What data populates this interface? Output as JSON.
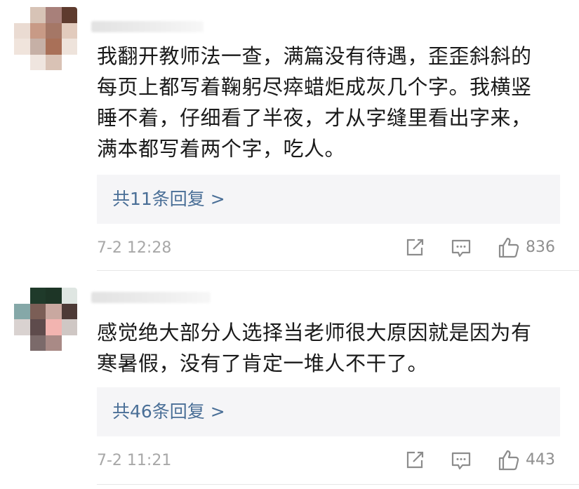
{
  "comments": [
    {
      "text_line1": "我翻开教师法一查，满篇没有待遇，歪歪斜斜的",
      "text_line2": "每页上都写着鞠躬尽瘁蜡炬成灰几个字。我横竖",
      "text_line3": "睡不着，仔细看了半夜，才从字缝里看出字来，",
      "text_line4": "满本都写着两个字，吃人。",
      "replies_label": "共11条回复 >",
      "time": "7-2 12:28",
      "like_count": "836",
      "avatar_colors": [
        "#ffffff",
        "#d7c3b6",
        "#a8807a",
        "#5e3b2e",
        "#eadbd2",
        "#c89a86",
        "#a57766",
        "#e2cbbd",
        "#f0e4dc",
        "#c6b0a6",
        "#a97058",
        "#eee3db",
        "#ffffff",
        "#efe5df",
        "#d9c2b5",
        "#ffffff"
      ]
    },
    {
      "text_line1": "感觉绝大部分人选择当老师很大原因就是因为有",
      "text_line2": "寒暑假，没有了肯定一堆人不干了。",
      "replies_label": "共46条回复 >",
      "time": "7-2 11:21",
      "like_count": "443",
      "avatar_colors": [
        "#ffffff",
        "#1f3a2a",
        "#1d3526",
        "#dfe6e2",
        "#85a8a8",
        "#7b5e56",
        "#c9a8a0",
        "#4d3a36",
        "#d9d2d0",
        "#5e4b4c",
        "#f2b4b0",
        "#cfc7c4",
        "#ffffff",
        "#7b6a6a",
        "#a98a86",
        "#ffffff"
      ]
    }
  ],
  "colors": {
    "link": "#4a6f97",
    "meta": "#a8a8a8",
    "reply_bg": "#f5f5f7"
  },
  "icons": {
    "share": "share-icon",
    "comment": "comment-icon",
    "like": "thumbs-up-icon"
  }
}
